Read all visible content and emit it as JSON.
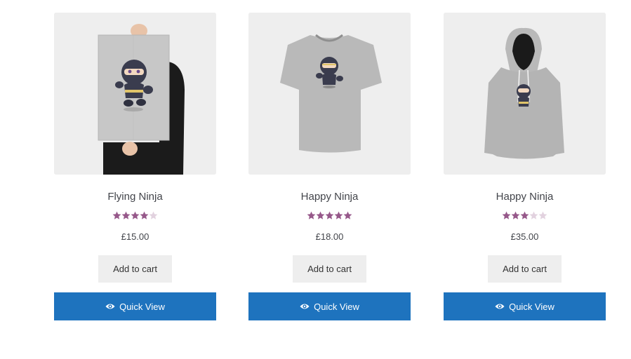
{
  "colors": {
    "star_filled": "#96588a",
    "star_empty": "#e2d2df",
    "quickview_bg": "#1e73be",
    "cart_bg": "#eeeeee",
    "image_bg": "#eeeeee"
  },
  "products": [
    {
      "title": "Flying Ninja",
      "price": "£15.00",
      "rating": 4,
      "rating_max": 5,
      "image": "ninja-poster-image",
      "add_to_cart_label": "Add to cart",
      "quick_view_label": "Quick View"
    },
    {
      "title": "Happy Ninja",
      "price": "£18.00",
      "rating": 5,
      "rating_max": 5,
      "image": "ninja-tshirt-image",
      "add_to_cart_label": "Add to cart",
      "quick_view_label": "Quick View"
    },
    {
      "title": "Happy Ninja",
      "price": "£35.00",
      "rating": 3,
      "rating_max": 5,
      "image": "ninja-hoodie-image",
      "add_to_cart_label": "Add to cart",
      "quick_view_label": "Quick View"
    }
  ]
}
